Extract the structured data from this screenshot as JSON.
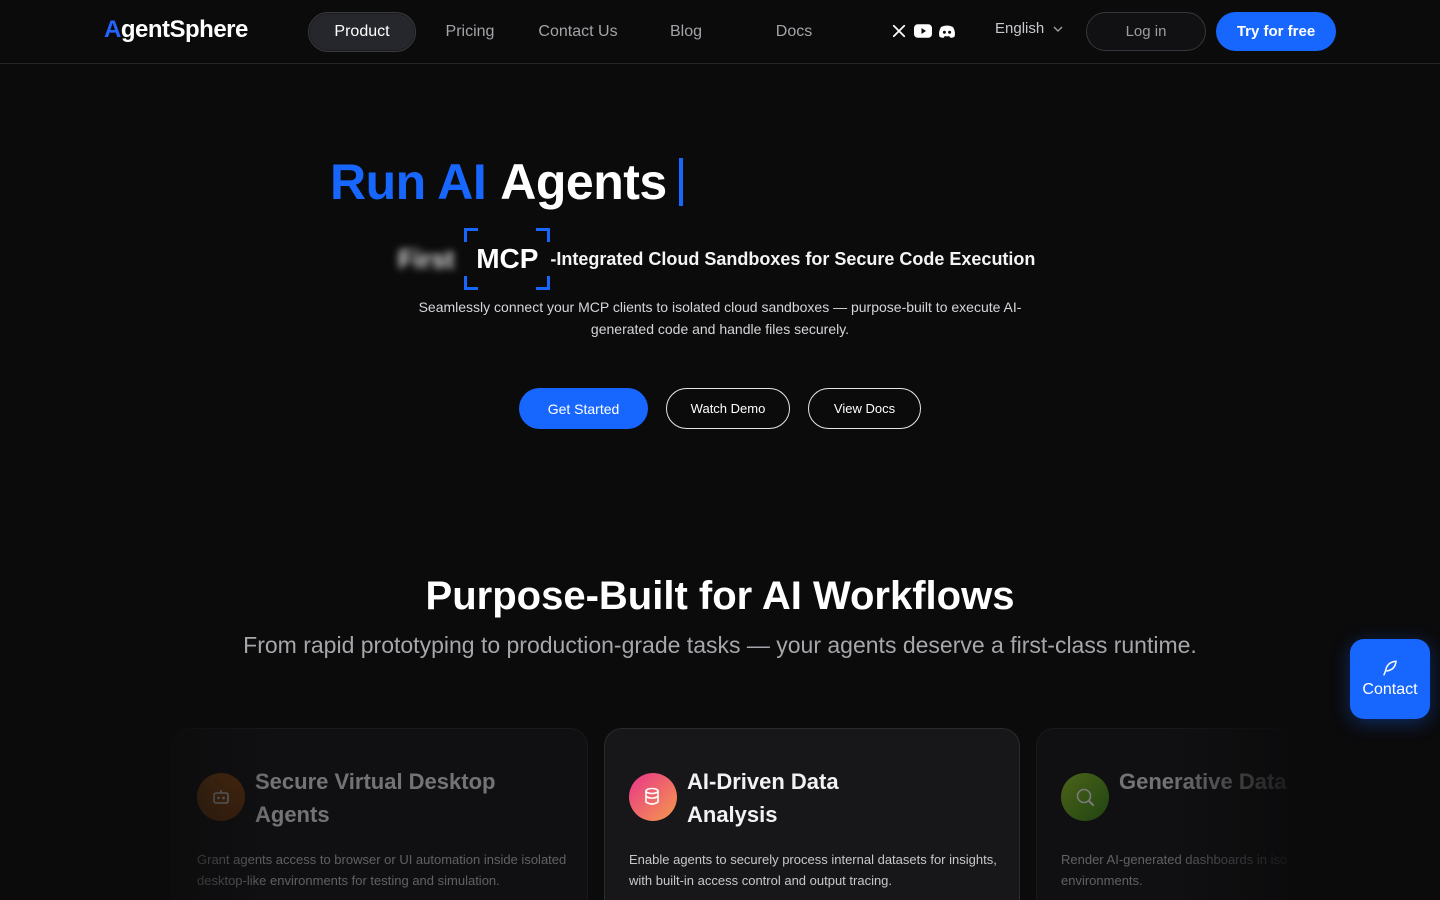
{
  "brand": {
    "logo_a": "A",
    "logo_rest": "gentSphere"
  },
  "nav": {
    "items": [
      {
        "label": "Product",
        "active": true
      },
      {
        "label": "Pricing"
      },
      {
        "label": "Contact Us"
      },
      {
        "label": "Blog"
      },
      {
        "label": "Docs"
      }
    ],
    "socials": [
      "x-icon",
      "youtube-icon",
      "discord-icon"
    ],
    "language": "English",
    "login_label": "Log in",
    "try_label": "Try for free"
  },
  "hero": {
    "title_blue": "Run AI",
    "title_white": "Agents",
    "blur_word": "First",
    "mcp": "MCP",
    "subhead_rest": "-Integrated Cloud Sandboxes for Secure Code Execution",
    "description": "Seamlessly connect your MCP clients to isolated cloud sandboxes — purpose-built to execute AI-generated code and handle files securely.",
    "cta_primary": "Get Started",
    "cta_demo": "Watch Demo",
    "cta_docs": "View Docs"
  },
  "section": {
    "title": "Purpose-Built for AI Workflows",
    "subtitle": "From rapid prototyping to production-grade tasks — your agents deserve a first-class runtime."
  },
  "cards": [
    {
      "title": "Secure Virtual Desktop Agents",
      "description": "Grant agents access to browser or UI automation inside isolated desktop-like environments for testing and simulation.",
      "icon": "robot-icon"
    },
    {
      "title": "AI-Driven Data Analysis",
      "description": "Enable agents to securely process internal datasets for insights, with built-in access control and output tracing.",
      "icon": "database-icon"
    },
    {
      "title": "Generative Data Visualization",
      "description": "Render AI-generated dashboards in isolated and auditable environments.",
      "icon": "data-search-icon"
    }
  ],
  "contact_fab": {
    "label": "Contact",
    "icon": "feather-icon"
  },
  "colors": {
    "accent": "#1767ff",
    "background": "#0b0b0c"
  }
}
